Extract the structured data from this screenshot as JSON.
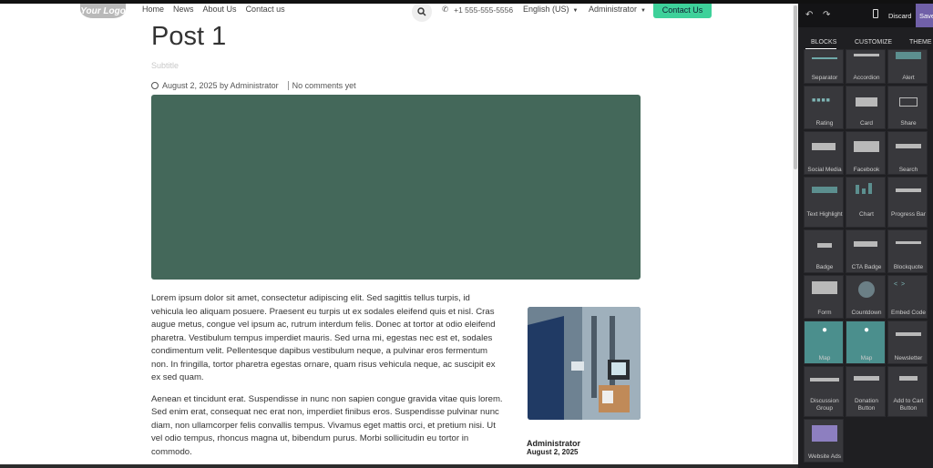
{
  "header": {
    "logo_text": "Your Logo",
    "nav": [
      "Home",
      "News",
      "About Us",
      "Contact us"
    ],
    "phone": "+1 555-555-5556",
    "language": "English (US)",
    "user": "Administrator",
    "contact_button": "Contact Us"
  },
  "post": {
    "title": "Post 1",
    "subtitle": "Subtitle",
    "date_author": "August 2, 2025 by Administrator",
    "comments": "No comments yet",
    "paragraphs": [
      "Lorem ipsum dolor sit amet, consectetur adipiscing elit. Sed sagittis tellus turpis, id vehicula leo aliquam posuere. Praesent eu turpis ut ex sodales eleifend quis et nisl. Cras augue metus, congue vel ipsum ac, rutrum interdum felis. Donec at tortor at odio eleifend pharetra. Vestibulum tempus imperdiet mauris. Sed urna mi, egestas nec est et, sodales condimentum velit. Pellentesque dapibus vestibulum neque, a pulvinar eros fermentum non. In fringilla, tortor pharetra egestas ornare, quam risus vehicula neque, ac suscipit ex ex sed quam.",
      "Aenean et tincidunt erat. Suspendisse in nunc non sapien congue gravida vitae quis lorem. Sed enim erat, consequat nec erat non, imperdiet finibus eros. Suspendisse pulvinar nunc diam, non ullamcorper felis convallis tempus. Vivamus eget mattis orci, et pretium nisi. Ut vel odio tempus, rhoncus magna ut, bibendum purus. Morbi sollicitudin eu tortor in commodo."
    ],
    "author_name": "Administrator",
    "author_date": "August 2, 2025"
  },
  "editor": {
    "discard": "Discard",
    "save": "Save",
    "tabs": [
      "BLOCKS",
      "CUSTOMIZE",
      "THEME"
    ],
    "blocks": [
      [
        "Separator",
        "Accordion",
        "Alert"
      ],
      [
        "Rating",
        "Card",
        "Share"
      ],
      [
        "Social Media",
        "Facebook",
        "Search"
      ],
      [
        "Text Highlight",
        "Chart",
        "Progress Bar"
      ],
      [
        "Badge",
        "CTA Badge",
        "Blockquote"
      ],
      [
        "Form",
        "Countdown",
        "Embed Code"
      ],
      [
        "Map",
        "Map",
        "Newsletter"
      ],
      [
        "Discussion Group",
        "Donation Button",
        "Add to Cart Button"
      ],
      [
        "Website Ads"
      ]
    ]
  }
}
